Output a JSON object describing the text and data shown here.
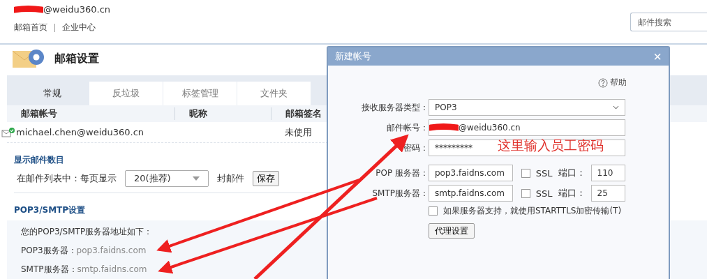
{
  "header": {
    "account": "@weidu360.cn",
    "links": [
      "邮箱首页",
      "企业中心"
    ],
    "search": {
      "placeholder": "邮件搜索"
    }
  },
  "settings": {
    "title": "邮箱设置",
    "tabs": [
      {
        "label": "常规",
        "selected": true
      },
      {
        "label": "反垃圾",
        "selected": false
      },
      {
        "label": "标签管理",
        "selected": false
      },
      {
        "label": "文件夹",
        "selected": false
      }
    ],
    "table": {
      "columns": [
        "邮箱帐号",
        "昵称",
        "邮箱签名"
      ],
      "rows": [
        {
          "account": "michael.chen@weidu360.cn",
          "nickname": "",
          "signature": "未使用"
        }
      ]
    },
    "display_count": {
      "heading": "显示邮件数目",
      "label": "在邮件列表中：每页显示",
      "value": "20(推荐)",
      "unit": "封邮件",
      "save": "保存"
    },
    "pop_smtp": {
      "heading": "POP3/SMTP设置",
      "intro": "您的POP3/SMTP服务器地址如下：",
      "servers": [
        {
          "label": "POP3服务器：",
          "value": "pop3.faidns.com"
        },
        {
          "label": "SMTP服务器：",
          "value": "smtp.faidns.com"
        }
      ]
    }
  },
  "dialog": {
    "title": "新建帐号",
    "close": "×",
    "help": "帮助",
    "server_type": {
      "label": "接收服务器类型：",
      "value": "POP3"
    },
    "account": {
      "label": "邮件帐号：",
      "value": "@weidu360.cn"
    },
    "password": {
      "label": "密码：",
      "value": "*********"
    },
    "servers": [
      {
        "label": "POP 服务器：",
        "host": "pop3.faidns.com",
        "ssl_label": "SSL",
        "ssl": false,
        "port_label": "端口：",
        "port": "110"
      },
      {
        "label": "SMTP服务器：",
        "host": "smtp.faidns.com",
        "ssl_label": "SSL",
        "ssl": false,
        "port_label": "端口：",
        "port": "25"
      }
    ],
    "starttls": {
      "label": "如果服务器支持，就使用STARTTLS加密传输(T)",
      "checked": false
    },
    "proxy_button": "代理设置"
  },
  "annotation": {
    "text": "这里输入员工密码"
  }
}
